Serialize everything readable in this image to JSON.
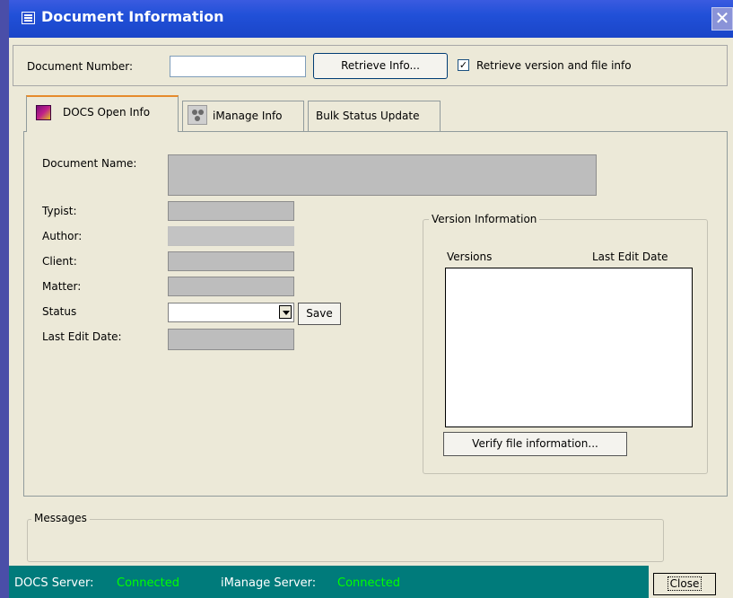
{
  "window": {
    "title": "Document Information",
    "close_glyph": "✕"
  },
  "top": {
    "doc_number_label": "Document Number:",
    "doc_number_value": "",
    "retrieve_button": "Retrieve Info...",
    "retrieve_version_checked": true,
    "retrieve_version_label": "Retrieve version and file info",
    "check_glyph": "✓"
  },
  "tabs": [
    {
      "label": "DOCS Open Info",
      "icon": "docs-open-icon",
      "active": true
    },
    {
      "label": "iManage Info",
      "icon": "imanage-icon",
      "active": false
    },
    {
      "label": "Bulk Status Update",
      "active": false
    }
  ],
  "docs_form": {
    "document_name_label": "Document Name:",
    "typist_label": "Typist:",
    "author_label": "Author:",
    "client_label": "Client:",
    "matter_label": "Matter:",
    "status_label": "Status",
    "status_value": "",
    "save_button": "Save",
    "last_edit_label": "Last Edit Date:"
  },
  "version_info": {
    "group_label": "Version Information",
    "col_versions": "Versions",
    "col_last_edit": "Last Edit Date",
    "rows": [],
    "verify_button": "Verify file information..."
  },
  "messages": {
    "label": "Messages",
    "text": ""
  },
  "status_bar": {
    "docs_label": "DOCS Server:",
    "docs_status": "Connected",
    "imanage_label": "iManage Server:",
    "imanage_status": "Connected",
    "status_color": "#00ff00",
    "bar_color": "#007b7b"
  },
  "close_button": "Close"
}
